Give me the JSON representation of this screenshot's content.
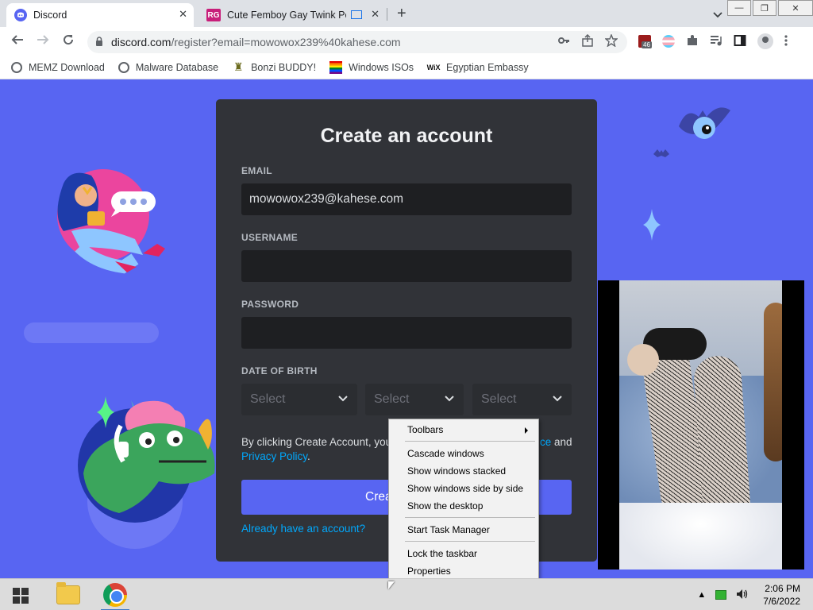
{
  "tabs": [
    {
      "title": "Discord",
      "close": "✕"
    },
    {
      "title": "Cute Femboy Gay Twink Porn",
      "close": "✕",
      "favicon": "RG"
    }
  ],
  "new_tab": "+",
  "window_controls": {
    "minimize": "—",
    "restore": "❐",
    "close": "✕"
  },
  "address": {
    "host": "discord.com",
    "path": "/register?email=mowowox239%40kahese.com"
  },
  "extension_badge": "46",
  "bookmarks": [
    {
      "label": "MEMZ Download",
      "icon": "globe-icon"
    },
    {
      "label": "Malware Database",
      "icon": "globe-icon"
    },
    {
      "label": "Bonzi BUDDY!",
      "icon": "bonzi-icon"
    },
    {
      "label": "Windows ISOs",
      "icon": "rainbow-flag-icon"
    },
    {
      "label": "Egyptian Embassy",
      "icon": "wix-icon",
      "icon_text": "WiX"
    }
  ],
  "form": {
    "title": "Create an account",
    "email_label": "EMAIL",
    "email_value": "mowowox239@kahese.com",
    "username_label": "USERNAME",
    "password_label": "PASSWORD",
    "dob_label": "DATE OF BIRTH",
    "dob_selects": [
      "Select",
      "Select",
      "Select"
    ],
    "tos_prefix": "By clicking Create Account, you",
    "tos_link_tail": "ce",
    "tos_and": " and",
    "privacy_link": "Privacy Policy",
    "privacy_tail": ".",
    "create_button": "Crea",
    "login_link": "Already have an account?"
  },
  "context_menu": {
    "items": [
      "Toolbars",
      "Cascade windows",
      "Show windows stacked",
      "Show windows side by side",
      "Show the desktop",
      "Start Task Manager",
      "Lock the taskbar",
      "Properties"
    ]
  },
  "taskbar": {
    "time": "2:06 PM",
    "date": "7/6/2022"
  },
  "colors": {
    "discord_blurple": "#5865f2",
    "card": "#313338",
    "input": "#1e1f22",
    "link": "#00a8fc"
  }
}
